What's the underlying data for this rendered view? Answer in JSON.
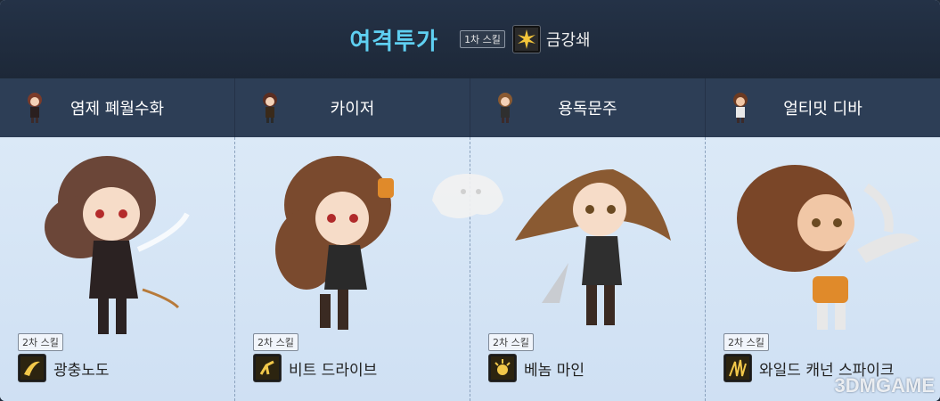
{
  "header": {
    "title": "여격투가",
    "first_skill_badge": "1차 스킬",
    "first_skill_name": "금강쇄",
    "first_skill_icon": "lightning-burst-icon"
  },
  "tabs": [
    {
      "label": "염제 폐월수화",
      "avatar": "character-avatar-icon"
    },
    {
      "label": "카이저",
      "avatar": "character-avatar-icon"
    },
    {
      "label": "용독문주",
      "avatar": "character-avatar-icon"
    },
    {
      "label": "얼티밋 디바",
      "avatar": "character-avatar-icon"
    }
  ],
  "panels": [
    {
      "badge": "2차 스킬",
      "skill_name": "광충노도",
      "skill_icon": "wave-slash-icon"
    },
    {
      "badge": "2차 스킬",
      "skill_name": "비트 드라이브",
      "skill_icon": "kick-icon"
    },
    {
      "badge": "2차 스킬",
      "skill_name": "베놈 마인",
      "skill_icon": "mine-burst-icon"
    },
    {
      "badge": "2차 스킬",
      "skill_name": "와일드 캐넌 스파이크",
      "skill_icon": "spike-burst-icon"
    }
  ],
  "watermark": "3DMGAME",
  "colors": {
    "title": "#5fd0f2",
    "header_bg": "#1d2838",
    "tab_bg": "#2d3e56",
    "panel_bg": "#d6e6f6"
  }
}
